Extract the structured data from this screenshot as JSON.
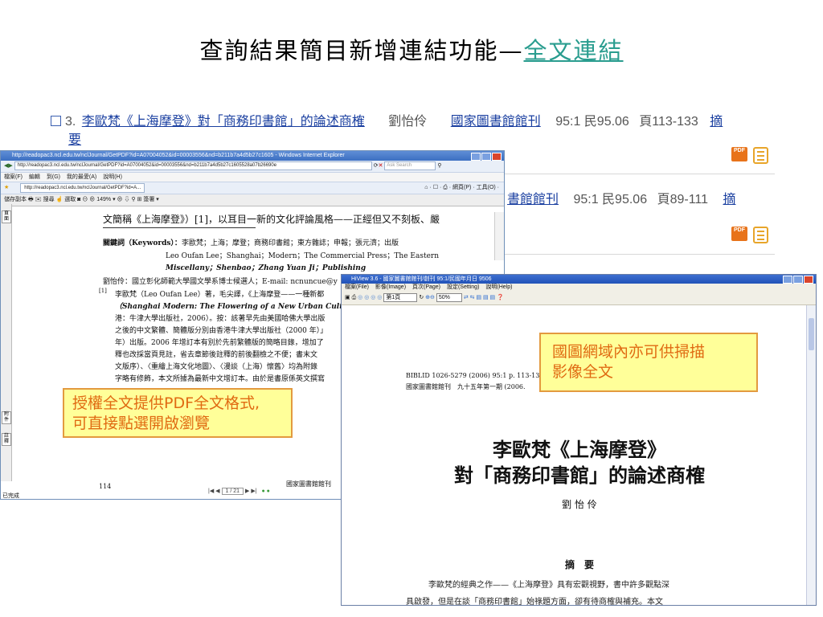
{
  "slide": {
    "title_prefix": "查詢結果簡目新增連結功能—",
    "title_link": "全文連結"
  },
  "results": [
    {
      "number": "3.",
      "title": "李歐梵《上海摩登》對「商務印書館」的論述商榷",
      "author": "劉怡伶",
      "journal": "國家圖書館館刊",
      "issue": "95:1 民95.06",
      "pages": "頁113-133",
      "abstract_part1": "摘",
      "abstract_part2": "要"
    },
    {
      "journal_partial": "書館館刊",
      "issue": "95:1 民95.06",
      "pages": "頁89-111",
      "abstract_part1": "摘"
    }
  ],
  "badges": {
    "pdf": "PDF",
    "pdf_color": "#e8731a",
    "doc_color": "#e8a52a"
  },
  "ie_window": {
    "title": "http://readopac3.ncl.edu.tw/nclJournal/GetPDF?id=A07004052&id=00003556&nd=b211b7a4d5b27c1605 - Windows Internet Explorer",
    "address": "http://readopac3.ncl.edu.tw/nclJournal/GetPDF?id=A07004052&id=00003556&nd=b211b7a4d5b27c1605528a07b26690e",
    "search_placeholder": "Ask Search",
    "menu": [
      "檔案(F)",
      "編輯",
      "到(G)",
      "我的最愛(A)",
      "說明(H)"
    ],
    "tab_label": "http://readopac3.ncl.edu.tw/nclJournal/GetPDF?id=A...",
    "right_toolbar": "⌂ · ☐ · ⎙ · 網頁(P) · 工具(O) ·",
    "acrobat_tools": "儲存副本  🖶  ✉  搜尋  ☝ 選取  ◙  ⊖  ⊕  149%  ▾  ⊕  ⇩  ⚲  ⊞  簽署 ▾",
    "zoom_value": "149%",
    "side_tabs": [
      "頁面",
      "附件",
      "註釋"
    ],
    "content": {
      "line1": "文簡稱《上海摩登》）[1]，以耳目一新的文化評論風格——正經但又不刻板、嚴",
      "keywords_label": "關鍵詞（Keywords）：",
      "keywords_zh": "李歐梵；上海；摩登；商務印書館；東方雜誌；申報；張元濟；出版",
      "keywords_en1": "Leo Oufan Lee；Shanghai；Modern；The Commercial Press；The Eastern",
      "keywords_en2": "Miscellany；Shenbao；Zhang Yuan Ji；Publishing",
      "author_line": "劉怡伶：國立彰化師範大學國文學系博士候選人；E-mail: ncnuncue@y",
      "fn_mark": "[1]",
      "fn1": "李歐梵（Leo Oufan Lee）著，毛尖譯，《上海摩登——一種新都",
      "fn2": "（Shanghai Modern: The Flowering of a New Urban Culture in Chi",
      "fn3": "港：牛津大學出版社，2006）。按：該著早先由美國哈佛大學出版",
      "fn4": "之後的中文繁體、簡體版分別由香港牛津大學出版社（2000 年）」",
      "fn5": "年）出版。2006 年增訂本有別於先前繁體版的簡略目錄，增加了",
      "fn6": "釋也改採當頁見註，省去章節後註釋的前後翻檢之不便；書末文",
      "fn7": "文版序）、〈重繪上海文化地圖〉、〈漫談（上海）懷舊〉均為附錄",
      "fn8": "字略有修飾，本文所據為最新中文增訂本。由於是書原係英文撰寫",
      "page_number": "114",
      "footer_text": "國家圖書館館刊",
      "page_nav": "1 / 21",
      "status": "已完成"
    }
  },
  "hiview_window": {
    "title": "HiView 3.6 - 國家圖書館館刊/創刊 95:1/民國年月日 9506",
    "menu": [
      "檔案(File)",
      "影像(Image)",
      "頁次(Page)",
      "設定(Setting)",
      "說明(Help)"
    ],
    "page_select": "第1頁",
    "zoom": "50%",
    "content": {
      "biblid": "BIBLID 1026-5279 (2006) 95:1 p. 113-133",
      "journal_line": "國家圖書館館刊　九十五年第一期 (2006.",
      "title_line1": "李歐梵《上海摩登》",
      "title_line2": "對「商務印書館」的論述商榷",
      "author": "劉 怡 伶",
      "abstract_heading": "摘　要",
      "abstract_line1": "李歐梵的經典之作——《上海摩登》具有宏觀視野，書中許多觀點深",
      "abstract_line2": "具啟發，但是在談「商務印書館」始祿題方面，卻有待商榷與補充。本文"
    }
  },
  "callouts": {
    "pdf_note_line1": "授權全文提供PDF全文格式,",
    "pdf_note_line2": "可直接點選開啟瀏覽",
    "scan_note_line1": "國圖網域內亦可供掃描",
    "scan_note_line2": "影像全文"
  }
}
